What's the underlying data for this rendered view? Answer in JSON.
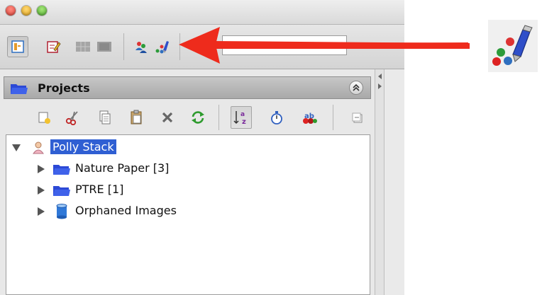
{
  "colors": {
    "selection": "#2f5fd3",
    "arrow": "#ee2b1c",
    "folder": "#2c49d6"
  },
  "window": {
    "traffic_lights": [
      "close",
      "minimize",
      "zoom"
    ]
  },
  "toolbar": {
    "buttons": [
      {
        "icon": "data-manager-icon",
        "pressed": true
      },
      {
        "icon": "annotation-icon",
        "pressed": false
      },
      {
        "icon": "grid-view-icon",
        "pressed": false
      },
      {
        "icon": "split-view-icon",
        "pressed": false
      },
      {
        "icon": "users-icon",
        "pressed": false
      },
      {
        "icon": "pen-shapes-icon",
        "pressed": false
      }
    ],
    "search_value": ""
  },
  "panel": {
    "title": "Projects",
    "collapse_icon": "double-chevron-up-icon"
  },
  "tree_toolbar": [
    "new-item-icon",
    "cut-icon",
    "copy-icon",
    "paste-icon",
    "delete-icon",
    "refresh-icon",
    "sort-alpha-icon",
    "stopwatch-icon",
    "tag-icon",
    "collapse-all-icon"
  ],
  "tree": {
    "root": {
      "label": "Polly Stack",
      "icon": "user-icon",
      "expanded": true,
      "selected": true
    },
    "children": [
      {
        "label": "Nature Paper [3]",
        "icon": "folder-icon"
      },
      {
        "label": "PTRE [1]",
        "icon": "folder-icon"
      },
      {
        "label": "Orphaned Images",
        "icon": "cylinder-icon"
      }
    ]
  },
  "zoomed_icon": "pen-shapes-icon"
}
